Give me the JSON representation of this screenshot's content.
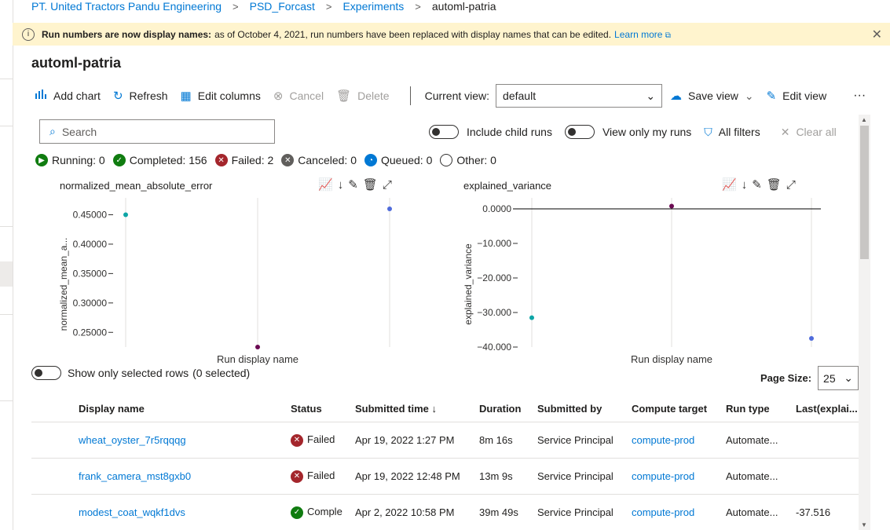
{
  "breadcrumb": {
    "items": [
      "PT. United Tractors Pandu Engineering",
      "PSD_Forcast",
      "Experiments"
    ],
    "current": "automl-patria",
    "separator": ">"
  },
  "banner": {
    "bold_text": "Run numbers are now display names:",
    "text": "as of October 4, 2021, run numbers have been replaced with display names that can be edited.",
    "link": "Learn more",
    "bg_color": "#fff4ce"
  },
  "page_title": "automl-patria",
  "toolbar": {
    "add_chart": "Add chart",
    "refresh": "Refresh",
    "edit_columns": "Edit columns",
    "cancel": "Cancel",
    "delete": "Delete",
    "current_view_label": "Current view:",
    "current_view_value": "default",
    "save_view": "Save view",
    "edit_view": "Edit view"
  },
  "search": {
    "placeholder": "Search"
  },
  "filters": {
    "include_child_runs": "Include child runs",
    "view_only_my_runs": "View only my runs",
    "all_filters": "All filters",
    "clear_all": "Clear all"
  },
  "status_counts": [
    {
      "label": "Running: 0",
      "color": "#107c10",
      "icon": "play-icon"
    },
    {
      "label": "Completed: 156",
      "color": "#107c10",
      "icon": "check-icon"
    },
    {
      "label": "Failed: 2",
      "color": "#a4262c",
      "icon": "x-icon"
    },
    {
      "label": "Canceled: 0",
      "color": "#605e5c",
      "icon": "x-icon"
    },
    {
      "label": "Queued: 0",
      "color": "#0078d4",
      "icon": "clock-icon"
    },
    {
      "label": "Other: 0",
      "color": "#ffffff",
      "icon": "circle-icon"
    }
  ],
  "chart_data": [
    {
      "type": "scatter",
      "title": "normalized_mean_absolute_error",
      "ylabel": "normalized_mean_a...",
      "xlabel": "Run display name",
      "yticks": [
        "0.45000",
        "0.40000",
        "0.35000",
        "0.30000",
        "0.25000"
      ],
      "ylim": [
        0.225,
        0.46
      ],
      "points": [
        {
          "x": 0,
          "y": 0.45,
          "color": "#0ea5a6"
        },
        {
          "x": 1,
          "y": 0.225,
          "color": "#6b0a52"
        },
        {
          "x": 2,
          "y": 0.46,
          "color": "#4f6bdb"
        }
      ]
    },
    {
      "type": "scatter",
      "title": "explained_variance",
      "ylabel": "explained_variance",
      "xlabel": "Run display name",
      "yticks": [
        "0.0000",
        "−10.000",
        "−20.000",
        "−30.000",
        "−40.000"
      ],
      "ylim": [
        -40,
        0
      ],
      "points": [
        {
          "x": 0,
          "y": -31.5,
          "color": "#0ea5a6"
        },
        {
          "x": 1,
          "y": 0.8,
          "color": "#6b0a52"
        },
        {
          "x": 2,
          "y": -37.5,
          "color": "#4f6bdb"
        }
      ]
    }
  ],
  "show_selected": {
    "label": "Show only selected rows",
    "count": "(0 selected)"
  },
  "page_size": {
    "label": "Page Size:",
    "value": "25"
  },
  "table": {
    "columns": [
      "Display name",
      "Status",
      "Submitted time ↓",
      "Duration",
      "Submitted by",
      "Compute target",
      "Run type",
      "Last(explai..."
    ],
    "rows": [
      {
        "name": "wheat_oyster_7r5rqqqg",
        "status": "Failed",
        "status_type": "failed",
        "submitted": "Apr 19, 2022 1:27 PM",
        "duration": "8m 16s",
        "by": "Service Principal",
        "compute": "compute-prod",
        "run_type": "Automate...",
        "last": ""
      },
      {
        "name": "frank_camera_mst8gxb0",
        "status": "Failed",
        "status_type": "failed",
        "submitted": "Apr 19, 2022 12:48 PM",
        "duration": "13m 9s",
        "by": "Service Principal",
        "compute": "compute-prod",
        "run_type": "Automate...",
        "last": ""
      },
      {
        "name": "modest_coat_wqkf1dvs",
        "status": "Comple",
        "status_type": "completed",
        "submitted": "Apr 2, 2022 10:58 PM",
        "duration": "39m 49s",
        "by": "Service Principal",
        "compute": "compute-prod",
        "run_type": "Automate...",
        "last": "-37.516"
      }
    ]
  }
}
